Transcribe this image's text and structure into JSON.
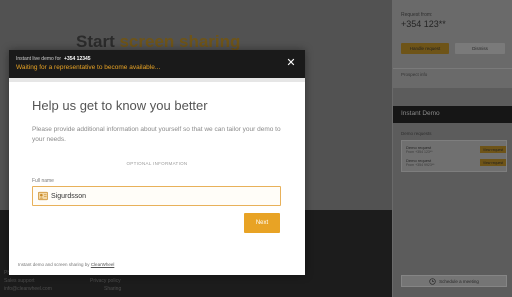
{
  "background": {
    "title_prefix": "Start",
    "title_accent": "screen sharing",
    "footer_texts": [
      "Sales support",
      "info@clearwheel.com",
      "Phone: +354 ...",
      "ClearWheel dev",
      "Privacy policy",
      "Sharing"
    ]
  },
  "modal": {
    "header_label": "Instant live demo for",
    "header_number": "+354 12345",
    "status": "Waiting for a representative to become available...",
    "close_icon": "close-icon",
    "title": "Help us get to know you better",
    "description": "Please provide additional information about yourself so that we can tailor your demo to your needs.",
    "optional_label": "OPTIONAL INFORMATION",
    "full_name_label": "Full name",
    "full_name_value": "Sigurdsson",
    "next_label": "Next",
    "footer_text": "Instant demo and screen sharing by",
    "footer_link": "ClearWheel"
  },
  "right_panel": {
    "request_from_label": "Request from:",
    "request_number": "+354 123**",
    "handle_label": "Handle request",
    "dismiss_label": "Dismiss",
    "prospect_label": "Prospect info",
    "instant_demo_title": "Instant Demo",
    "demo_requests_label": "Demo requests",
    "requests": [
      {
        "title": "Demo request",
        "from": "From +354 123**",
        "view_label": "View request"
      },
      {
        "title": "Demo request",
        "from": "From +354 9923**",
        "view_label": "View request"
      }
    ],
    "schedule_label": "Schedule a meeting"
  },
  "colors": {
    "accent": "#e8a325",
    "header_bg": "#1a1a1a"
  }
}
